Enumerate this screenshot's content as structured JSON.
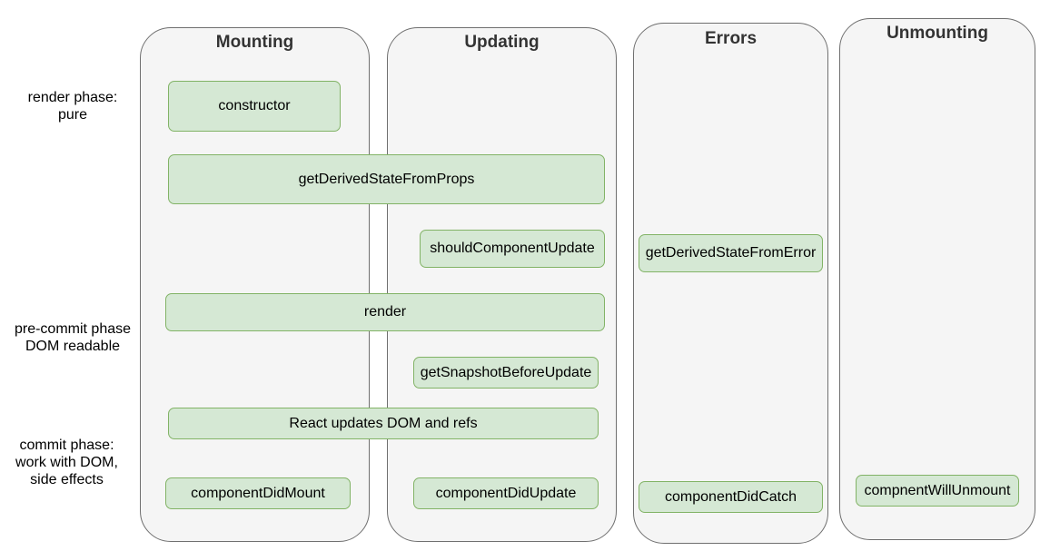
{
  "columns": {
    "mounting": "Mounting",
    "updating": "Updating",
    "errors": "Errors",
    "unmounting": "Unmounting"
  },
  "phases": {
    "render": "render phase:\npure",
    "precommit": "pre-commit phase\nDOM readable",
    "commit": "commit phase:\nwork with DOM,\nside effects"
  },
  "methods": {
    "constructor": "constructor",
    "get_derived_state_from_props": "getDerivedStateFromProps",
    "should_component_update": "shouldComponentUpdate",
    "render": "render",
    "get_snapshot_before_update": "getSnapshotBeforeUpdate",
    "react_updates_dom": "React updates DOM and refs",
    "component_did_mount": "componentDidMount",
    "component_did_update": "componentDidUpdate",
    "get_derived_state_from_error": "getDerivedStateFromError",
    "component_did_catch": "componentDidCatch",
    "component_will_unmount": "compnentWillUnmount"
  },
  "colors": {
    "column_fill": "#f5f5f5",
    "column_stroke": "#6f6f6f",
    "box_fill": "#d5e8d4",
    "box_stroke": "#82b366"
  }
}
